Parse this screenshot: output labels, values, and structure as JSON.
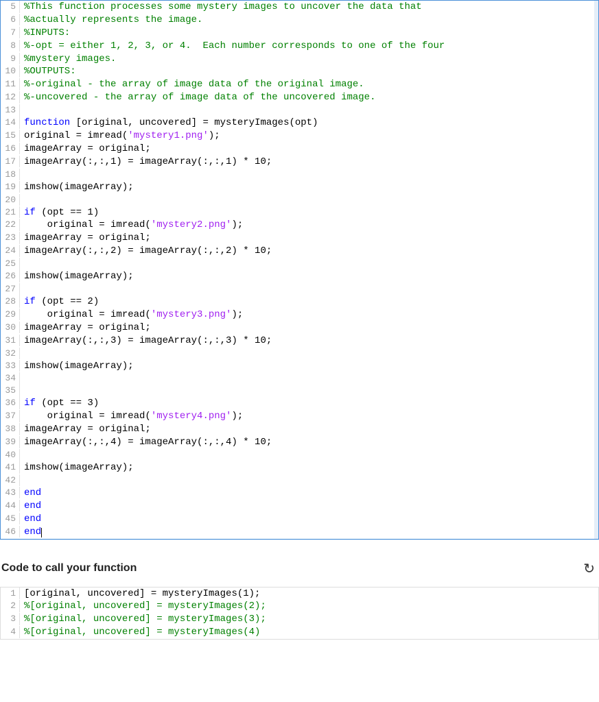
{
  "editor": {
    "lines": [
      {
        "n": 5,
        "tokens": [
          {
            "cls": "tok-comment",
            "t": "%This function processes some mystery images to uncover the data that"
          }
        ]
      },
      {
        "n": 6,
        "tokens": [
          {
            "cls": "tok-comment",
            "t": "%actually represents the image."
          }
        ]
      },
      {
        "n": 7,
        "tokens": [
          {
            "cls": "tok-comment",
            "t": "%INPUTS:"
          }
        ]
      },
      {
        "n": 8,
        "tokens": [
          {
            "cls": "tok-comment",
            "t": "%-opt = either 1, 2, 3, or 4.  Each number corresponds to one of the four"
          }
        ]
      },
      {
        "n": 9,
        "tokens": [
          {
            "cls": "tok-comment",
            "t": "%mystery images."
          }
        ]
      },
      {
        "n": 10,
        "tokens": [
          {
            "cls": "tok-comment",
            "t": "%OUTPUTS:"
          }
        ]
      },
      {
        "n": 11,
        "tokens": [
          {
            "cls": "tok-comment",
            "t": "%-original - the array of image data of the original image."
          }
        ]
      },
      {
        "n": 12,
        "tokens": [
          {
            "cls": "tok-comment",
            "t": "%-uncovered - the array of image data of the uncovered image."
          }
        ]
      },
      {
        "n": 13,
        "tokens": []
      },
      {
        "n": 14,
        "tokens": [
          {
            "cls": "tok-keyword",
            "t": "function"
          },
          {
            "cls": "tok-plain",
            "t": " [original, uncovered] = mysteryImages(opt)"
          }
        ]
      },
      {
        "n": 15,
        "tokens": [
          {
            "cls": "tok-plain",
            "t": "original = imread("
          },
          {
            "cls": "tok-string",
            "t": "'mystery1.png'"
          },
          {
            "cls": "tok-plain",
            "t": ");"
          }
        ]
      },
      {
        "n": 16,
        "tokens": [
          {
            "cls": "tok-plain",
            "t": "imageArray = original;"
          }
        ]
      },
      {
        "n": 17,
        "tokens": [
          {
            "cls": "tok-plain",
            "t": "imageArray(:,:,1) = imageArray(:,:,1) * 10;"
          }
        ]
      },
      {
        "n": 18,
        "tokens": []
      },
      {
        "n": 19,
        "tokens": [
          {
            "cls": "tok-plain",
            "t": "imshow(imageArray);"
          }
        ]
      },
      {
        "n": 20,
        "tokens": []
      },
      {
        "n": 21,
        "tokens": [
          {
            "cls": "tok-keyword",
            "t": "if"
          },
          {
            "cls": "tok-plain",
            "t": " (opt == 1)"
          }
        ]
      },
      {
        "n": 22,
        "tokens": [
          {
            "cls": "tok-plain",
            "t": "    original = imread("
          },
          {
            "cls": "tok-string",
            "t": "'mystery2.png'"
          },
          {
            "cls": "tok-plain",
            "t": ");"
          }
        ]
      },
      {
        "n": 23,
        "tokens": [
          {
            "cls": "tok-plain",
            "t": "imageArray = original;"
          }
        ]
      },
      {
        "n": 24,
        "tokens": [
          {
            "cls": "tok-plain",
            "t": "imageArray(:,:,2) = imageArray(:,:,2) * 10;"
          }
        ]
      },
      {
        "n": 25,
        "tokens": []
      },
      {
        "n": 26,
        "tokens": [
          {
            "cls": "tok-plain",
            "t": "imshow(imageArray);"
          }
        ]
      },
      {
        "n": 27,
        "tokens": []
      },
      {
        "n": 28,
        "tokens": [
          {
            "cls": "tok-keyword",
            "t": "if"
          },
          {
            "cls": "tok-plain",
            "t": " (opt == 2)"
          }
        ]
      },
      {
        "n": 29,
        "tokens": [
          {
            "cls": "tok-plain",
            "t": "    original = imread("
          },
          {
            "cls": "tok-string",
            "t": "'mystery3.png'"
          },
          {
            "cls": "tok-plain",
            "t": ");"
          }
        ]
      },
      {
        "n": 30,
        "tokens": [
          {
            "cls": "tok-plain",
            "t": "imageArray = original;"
          }
        ]
      },
      {
        "n": 31,
        "tokens": [
          {
            "cls": "tok-plain",
            "t": "imageArray(:,:,3) = imageArray(:,:,3) * 10;"
          }
        ]
      },
      {
        "n": 32,
        "tokens": []
      },
      {
        "n": 33,
        "tokens": [
          {
            "cls": "tok-plain",
            "t": "imshow(imageArray);"
          }
        ]
      },
      {
        "n": 34,
        "tokens": []
      },
      {
        "n": 35,
        "tokens": []
      },
      {
        "n": 36,
        "tokens": [
          {
            "cls": "tok-keyword",
            "t": "if"
          },
          {
            "cls": "tok-plain",
            "t": " (opt == 3)"
          }
        ]
      },
      {
        "n": 37,
        "tokens": [
          {
            "cls": "tok-plain",
            "t": "    original = imread("
          },
          {
            "cls": "tok-string",
            "t": "'mystery4.png'"
          },
          {
            "cls": "tok-plain",
            "t": ");"
          }
        ]
      },
      {
        "n": 38,
        "tokens": [
          {
            "cls": "tok-plain",
            "t": "imageArray = original;"
          }
        ]
      },
      {
        "n": 39,
        "tokens": [
          {
            "cls": "tok-plain",
            "t": "imageArray(:,:,4) = imageArray(:,:,4) * 10;"
          }
        ]
      },
      {
        "n": 40,
        "tokens": []
      },
      {
        "n": 41,
        "tokens": [
          {
            "cls": "tok-plain",
            "t": "imshow(imageArray);"
          }
        ]
      },
      {
        "n": 42,
        "tokens": []
      },
      {
        "n": 43,
        "tokens": [
          {
            "cls": "tok-keyword",
            "t": "end"
          }
        ]
      },
      {
        "n": 44,
        "tokens": [
          {
            "cls": "tok-keyword",
            "t": "end"
          }
        ]
      },
      {
        "n": 45,
        "tokens": [
          {
            "cls": "tok-keyword",
            "t": "end"
          }
        ]
      },
      {
        "n": 46,
        "tokens": [
          {
            "cls": "tok-keyword",
            "t": "end"
          }
        ],
        "cursor": true
      }
    ]
  },
  "section_title": "Code to call your function",
  "reset_icon_glyph": "↻",
  "call_block": {
    "lines": [
      {
        "n": 1,
        "tokens": [
          {
            "cls": "tok-plain",
            "t": "[original, uncovered] = mysteryImages(1);"
          }
        ]
      },
      {
        "n": 2,
        "tokens": [
          {
            "cls": "tok-comment",
            "t": "%[original, uncovered] = mysteryImages(2);"
          }
        ]
      },
      {
        "n": 3,
        "tokens": [
          {
            "cls": "tok-comment",
            "t": "%[original, uncovered] = mysteryImages(3);"
          }
        ]
      },
      {
        "n": 4,
        "tokens": [
          {
            "cls": "tok-comment",
            "t": "%[original, uncovered] = mysteryImages(4)"
          }
        ]
      }
    ]
  }
}
